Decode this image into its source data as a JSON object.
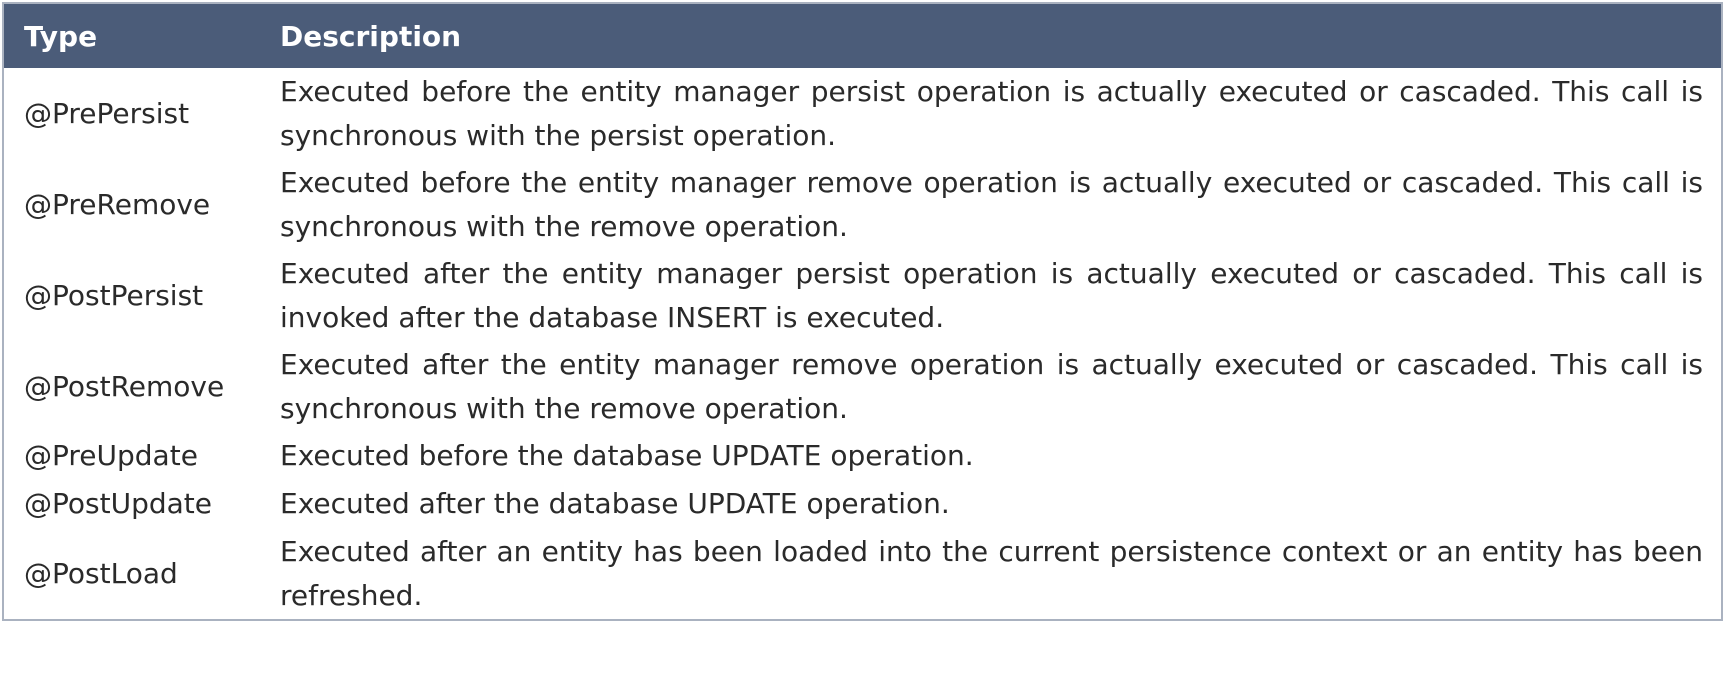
{
  "header": {
    "type_label": "Type",
    "description_label": "Description"
  },
  "rows": [
    {
      "type": "@PrePersist",
      "description": "Executed before the entity manager persist operation is actually executed or cascaded. This call is synchronous with the persist operation."
    },
    {
      "type": "@PreRemove",
      "description": "Executed before the entity manager remove operation is actually executed or cascaded. This call is synchronous with the remove operation."
    },
    {
      "type": "@PostPersist",
      "description": "Executed after the entity manager persist operation is actually executed or cascaded. This call is invoked after the database INSERT is executed."
    },
    {
      "type": "@PostRemove",
      "description": "Executed after the entity manager remove operation is actually executed or cascaded. This call is synchronous with the remove operation."
    },
    {
      "type": "@PreUpdate",
      "description": "Executed before the database UPDATE operation."
    },
    {
      "type": "@PostUpdate",
      "description": "Executed after the database UPDATE operation."
    },
    {
      "type": "@PostLoad",
      "description": "Executed after an entity has been loaded into the current persistence context or an entity has been refreshed."
    }
  ],
  "colors": {
    "header_background": "#4b5c79",
    "header_text": "#ffffff",
    "border": "#aab2c0"
  }
}
